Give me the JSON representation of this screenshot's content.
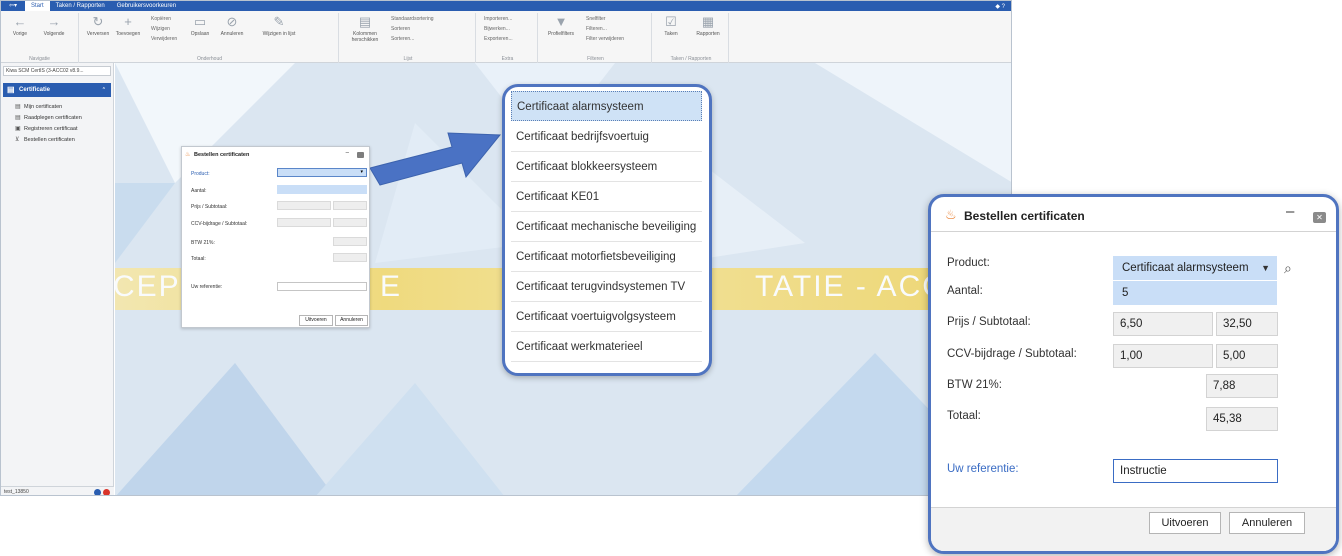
{
  "menubar": {
    "quick_access": "⇦▾",
    "tabs": [
      "Start",
      "Taken / Rapporten",
      "Gebruikersvoorkeuren"
    ],
    "right_icons": "◆  ?"
  },
  "ribbon": {
    "nav": {
      "back": "Vorige",
      "next": "Volgende",
      "group": "Navigatie"
    },
    "onderhoud": {
      "refresh": "Verversen",
      "add": "Toevoegen",
      "copy": "Kopiëren",
      "edit": "Wijzigen",
      "delete": "Verwijderen",
      "save": "Opslaan",
      "cancel": "Annuleren",
      "edit_list": "Wijzigen in lijst",
      "group": "Onderhoud"
    },
    "lijst": {
      "columns": "Kolommen herschikken",
      "std_sort": "Standaardsortering",
      "sort": "Sorteren",
      "sort2": "Sorteren...",
      "group": "Lijst"
    },
    "extra": {
      "import": "Importeren...",
      "update": "Bijwerken...",
      "export": "Exporteren...",
      "group": "Extra"
    },
    "filteren": {
      "profiles": "Profielfilters",
      "quick": "Snelfilter",
      "filter": "Filteren...",
      "remove": "Filter verwijderen",
      "group": "Filteren"
    },
    "taken": {
      "tasks": "Taken",
      "reports": "Rapporten",
      "group": "Taken / Rapporten"
    }
  },
  "nav": {
    "search": "Kiwa SCM CertIS (3-ACC02 v8.9...",
    "header": "Certificatie",
    "items": [
      "Mijn certificaten",
      "Raadplegen certificaten",
      "Registreren certificaat",
      "Bestellen certificaten"
    ],
    "user": "test_13850"
  },
  "banner": {
    "left": "CEPT",
    "mid": "E",
    "right": "TATIE - ACC"
  },
  "small_dialog": {
    "title": "Bestellen certificaten",
    "labels": [
      "Product:",
      "Aantal:",
      "Prijs / Subtotaal:",
      "CCV-bijdrage / Subtotaal:",
      "BTW 21%:",
      "Totaal:",
      "Uw referentie:"
    ],
    "execute": "Uitvoeren",
    "cancel": "Annuleren"
  },
  "dropdown": {
    "options": [
      "Certificaat alarmsysteem",
      "Certificaat bedrijfsvoertuig",
      "Certificaat blokkeersysteem",
      "Certificaat KE01",
      "Certificaat mechanische beveiliging",
      "Certificaat motorfietsbeveiliging",
      "Certificaat terugvindsystemen TV",
      "Certificaat voertuigvolgsysteem",
      "Certificaat werkmaterieel"
    ],
    "selected_index": 0
  },
  "dialog": {
    "title": "Bestellen certificaten",
    "product_label": "Product:",
    "product_value": "Certificaat alarmsysteem",
    "aantal_label": "Aantal:",
    "aantal_value": "5",
    "prijs_label": "Prijs / Subtotaal:",
    "prijs_value": "6,50",
    "prijs_sub": "32,50",
    "ccv_label": "CCV-bijdrage / Subtotaal:",
    "ccv_value": "1,00",
    "ccv_sub": "5,00",
    "btw_label": "BTW 21%:",
    "btw_value": "7,88",
    "totaal_label": "Totaal:",
    "totaal_value": "45,38",
    "ref_label": "Uw referentie:",
    "ref_value": "Instructie",
    "execute": "Uitvoeren",
    "cancel": "Annuleren"
  },
  "colors": {
    "accent": "#2a5db0",
    "callout_border": "#4f74c0",
    "selected": "#cfe2f6",
    "banner": "#f3d96b"
  }
}
